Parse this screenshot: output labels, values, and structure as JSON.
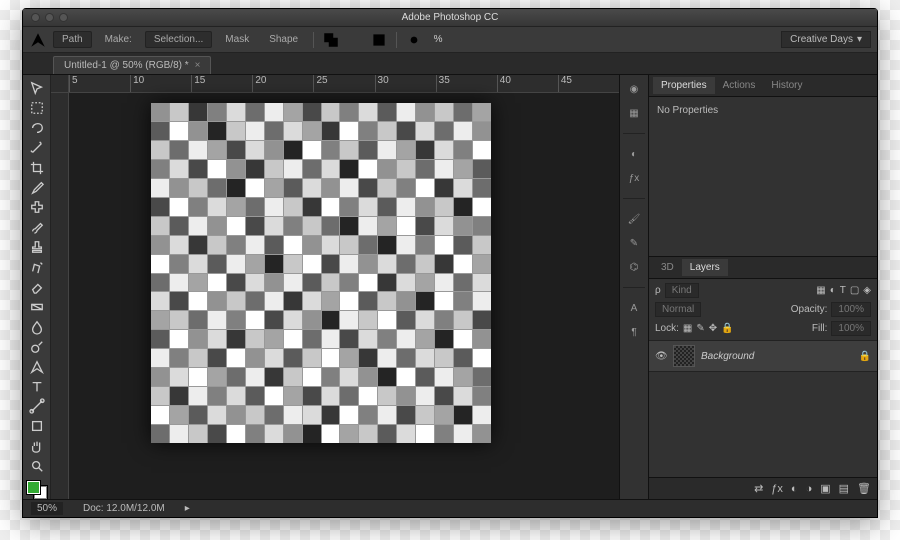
{
  "app_title": "Adobe Photoshop CC",
  "workspace": "Creative Days",
  "options": {
    "tool": "path",
    "make": "Make:",
    "sel": "Selection...",
    "mask": "Mask",
    "shape": "Shape"
  },
  "document": {
    "tab": "Untitled-1 @ 50% (RGB/8) *"
  },
  "status": {
    "zoom": "50%",
    "doc_label": "Doc:",
    "doc": "12.0M/12.0M"
  },
  "ruler": [
    "5",
    "10",
    "15",
    "20",
    "25",
    "30",
    "35",
    "40",
    "45"
  ],
  "panels": {
    "props_tabs": [
      "Properties",
      "Actions",
      "History"
    ],
    "no_props": "No Properties",
    "layer_tabs": [
      "3D",
      "Layers"
    ],
    "kind": "Kind",
    "blend": "Normal",
    "opacity_l": "Opacity:",
    "opacity": "100%",
    "lock": "Lock:",
    "fill_l": "Fill:",
    "fill": "100%",
    "bg_layer": "Background"
  },
  "tools": [
    "move",
    "marquee",
    "lasso",
    "wand",
    "crop",
    "eyedrop",
    "heal",
    "brush",
    "stamp",
    "history",
    "eraser",
    "gradient",
    "blur",
    "dodge",
    "pen",
    "type",
    "path",
    "rect",
    "hand",
    "zoom"
  ],
  "mid": [
    "color",
    "swatch",
    "adjust",
    "style",
    "brush",
    "brush2",
    "clone",
    "char",
    "para"
  ],
  "grid": [
    [
      8,
      11,
      3,
      7,
      12,
      6,
      13,
      9,
      4,
      11,
      7,
      12,
      5,
      13,
      8,
      11,
      6,
      9
    ],
    [
      5,
      14,
      8,
      2,
      11,
      13,
      6,
      12,
      9,
      3,
      14,
      7,
      11,
      4,
      12,
      6,
      13,
      8
    ],
    [
      11,
      6,
      13,
      9,
      4,
      12,
      8,
      2,
      14,
      7,
      11,
      5,
      13,
      9,
      3,
      12,
      7,
      14
    ],
    [
      7,
      12,
      4,
      14,
      8,
      3,
      11,
      13,
      6,
      12,
      2,
      14,
      8,
      11,
      6,
      13,
      9,
      5
    ],
    [
      13,
      8,
      11,
      6,
      2,
      14,
      9,
      5,
      12,
      8,
      13,
      4,
      11,
      7,
      14,
      3,
      12,
      6
    ],
    [
      4,
      14,
      7,
      12,
      9,
      6,
      13,
      11,
      3,
      14,
      7,
      12,
      5,
      13,
      8,
      11,
      2,
      14
    ],
    [
      11,
      5,
      13,
      8,
      14,
      4,
      12,
      7,
      11,
      6,
      2,
      13,
      9,
      14,
      4,
      12,
      8,
      7
    ],
    [
      8,
      12,
      3,
      11,
      7,
      13,
      5,
      14,
      8,
      12,
      11,
      6,
      2,
      13,
      7,
      14,
      5,
      11
    ],
    [
      14,
      7,
      12,
      5,
      13,
      9,
      2,
      11,
      14,
      4,
      13,
      8,
      12,
      6,
      11,
      3,
      14,
      9
    ],
    [
      6,
      13,
      9,
      14,
      4,
      12,
      8,
      13,
      5,
      11,
      7,
      14,
      3,
      12,
      9,
      13,
      6,
      12
    ],
    [
      12,
      4,
      14,
      8,
      11,
      6,
      13,
      3,
      12,
      9,
      14,
      5,
      11,
      8,
      2,
      14,
      7,
      13
    ],
    [
      9,
      11,
      6,
      13,
      7,
      14,
      4,
      12,
      8,
      2,
      13,
      11,
      14,
      5,
      12,
      7,
      11,
      4
    ],
    [
      5,
      14,
      8,
      12,
      3,
      11,
      9,
      14,
      6,
      13,
      4,
      12,
      7,
      13,
      9,
      2,
      14,
      8
    ],
    [
      13,
      7,
      11,
      4,
      14,
      8,
      12,
      5,
      11,
      14,
      9,
      3,
      13,
      6,
      12,
      11,
      5,
      14
    ],
    [
      8,
      12,
      14,
      9,
      6,
      13,
      3,
      11,
      14,
      7,
      12,
      8,
      2,
      14,
      5,
      13,
      9,
      6
    ],
    [
      11,
      3,
      13,
      7,
      12,
      5,
      14,
      9,
      4,
      12,
      6,
      14,
      11,
      8,
      13,
      4,
      12,
      7
    ],
    [
      14,
      9,
      5,
      12,
      8,
      11,
      6,
      13,
      12,
      3,
      14,
      7,
      13,
      4,
      11,
      9,
      2,
      13
    ],
    [
      6,
      13,
      11,
      4,
      14,
      7,
      12,
      8,
      2,
      14,
      9,
      11,
      5,
      12,
      14,
      7,
      13,
      8
    ]
  ]
}
